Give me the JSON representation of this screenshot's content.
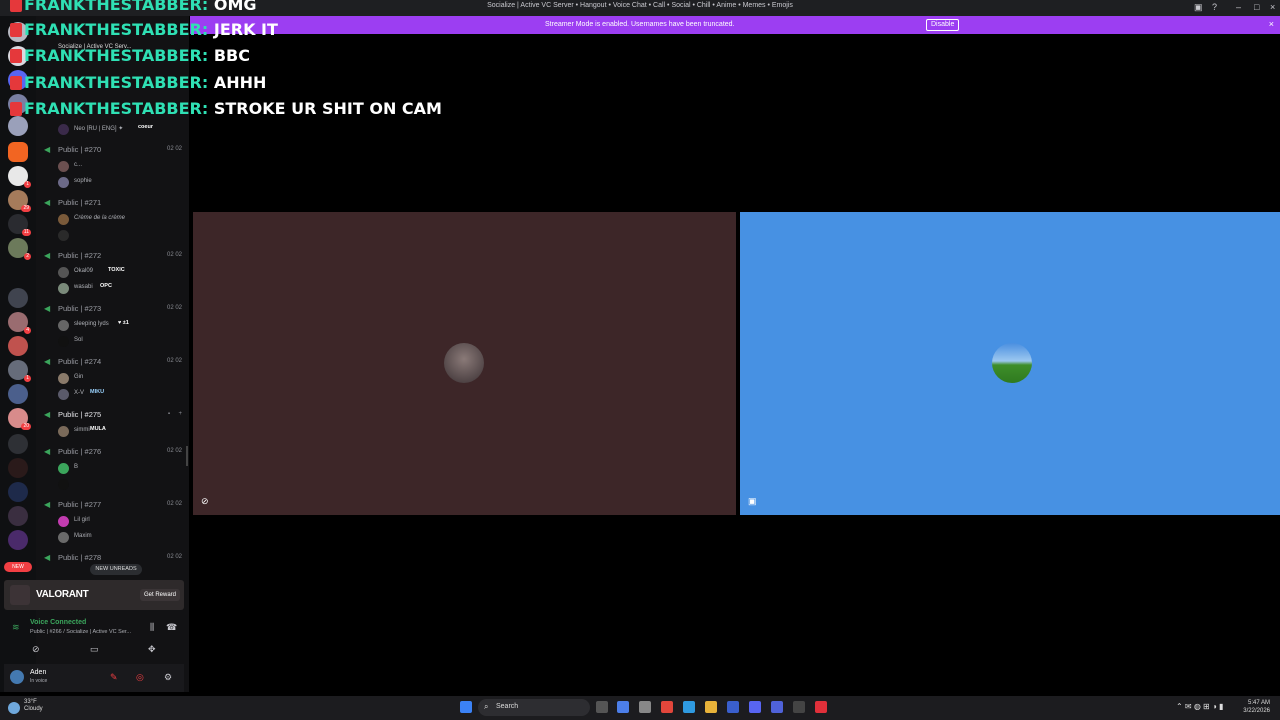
{
  "window": {
    "title": "Socialize | Active VC Server • Hangout • Voice Chat • Call • Social • Chill • Anime • Memes • Emojis"
  },
  "streamer_bar": {
    "message": "Streamer Mode is enabled. Usernames have been truncated.",
    "disable_label": "Disable"
  },
  "sidebar": {
    "server_name": "Socialize | Active VC Serv...",
    "channels": [
      {
        "name": "Public | #270",
        "count": "02 02",
        "users": [
          {
            "name": "c...",
            "tag": ""
          },
          {
            "name": "sophie",
            "tag": ""
          }
        ]
      },
      {
        "name": "Public | #271",
        "count": "",
        "users": [
          {
            "name": "Crème de la crème",
            "tag": ""
          },
          {
            "name": "",
            "tag": ""
          }
        ]
      },
      {
        "name": "Public | #272",
        "count": "02 02",
        "users": [
          {
            "name": "Okal09",
            "tag": "TOXIC"
          },
          {
            "name": "wasabi",
            "tag": "OPC"
          }
        ]
      },
      {
        "name": "Public | #273",
        "count": "02 02",
        "users": [
          {
            "name": "sleeping lyds",
            "tag": "♥ ±1"
          },
          {
            "name": "Sol",
            "tag": ""
          }
        ]
      },
      {
        "name": "Public | #274",
        "count": "02 02",
        "users": [
          {
            "name": "Gin",
            "tag": ""
          },
          {
            "name": "X-V",
            "tag": "MIKU"
          }
        ]
      },
      {
        "name": "Public | #275",
        "count": "",
        "users": [
          {
            "name": "simmi",
            "tag": "MULA"
          }
        ]
      },
      {
        "name": "Public | #276",
        "count": "02 02",
        "users": [
          {
            "name": "B",
            "tag": ""
          },
          {
            "name": "",
            "tag": ""
          }
        ]
      },
      {
        "name": "Public | #277",
        "count": "02 02",
        "users": [
          {
            "name": "Lil girl",
            "tag": ""
          },
          {
            "name": "Maxim",
            "tag": ""
          }
        ]
      },
      {
        "name": "Public | #278",
        "count": "02 02",
        "users": []
      }
    ],
    "hidden_above": {
      "name": "Neo [RU | ENG] ✦",
      "tag": "coeur"
    },
    "new_unreads": "NEW UNREADS",
    "promo": {
      "brand": "VALORANT",
      "button": "Get Reward"
    },
    "voice": {
      "status": "Voice Connected",
      "channel": "Public | #266 / Socialize | Active VC Ser..."
    },
    "user": {
      "name": "Aden",
      "status": "In voice"
    }
  },
  "rail": {
    "new_label": "NEW",
    "badges": [
      "1",
      "29",
      "11",
      "2",
      "4",
      "1",
      "20"
    ]
  },
  "chat_overlay": [
    {
      "user": "FRANKTHESTABBER:",
      "text": "OMG"
    },
    {
      "user": "FRANKTHESTABBER:",
      "text": "JERK IT"
    },
    {
      "user": "FRANKTHESTABBER:",
      "text": "BBC"
    },
    {
      "user": "FRANKTHESTABBER:",
      "text": "AHHH"
    },
    {
      "user": "FRANKTHESTABBER:",
      "text": "STROKE UR SHIT ON CAM"
    }
  ],
  "taskbar": {
    "weather_temp": "33°F",
    "weather_desc": "Cloudy",
    "search": "Search",
    "time": "5:47 AM",
    "date": "3/22/2026"
  },
  "colors": {
    "accent": "#9c3ef2",
    "voice_green": "#3ba55c",
    "chat_nick": "#2fe0b4",
    "tile_left": "#3d2628",
    "tile_right": "#4791e3"
  }
}
